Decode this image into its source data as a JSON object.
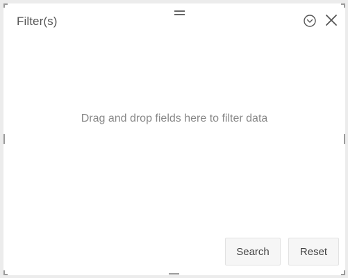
{
  "panel": {
    "title": "Filter(s)",
    "empty_message": "Drag and drop fields here to filter data",
    "icons": {
      "drag": "drag-handle-icon",
      "collapse": "chevron-down-circle-icon",
      "close": "close-icon"
    }
  },
  "actions": {
    "search_label": "Search",
    "reset_label": "Reset"
  },
  "colors": {
    "panel_background": "#ffffff",
    "page_background": "#ececec",
    "text_muted": "#888888",
    "icon": "#555555"
  }
}
